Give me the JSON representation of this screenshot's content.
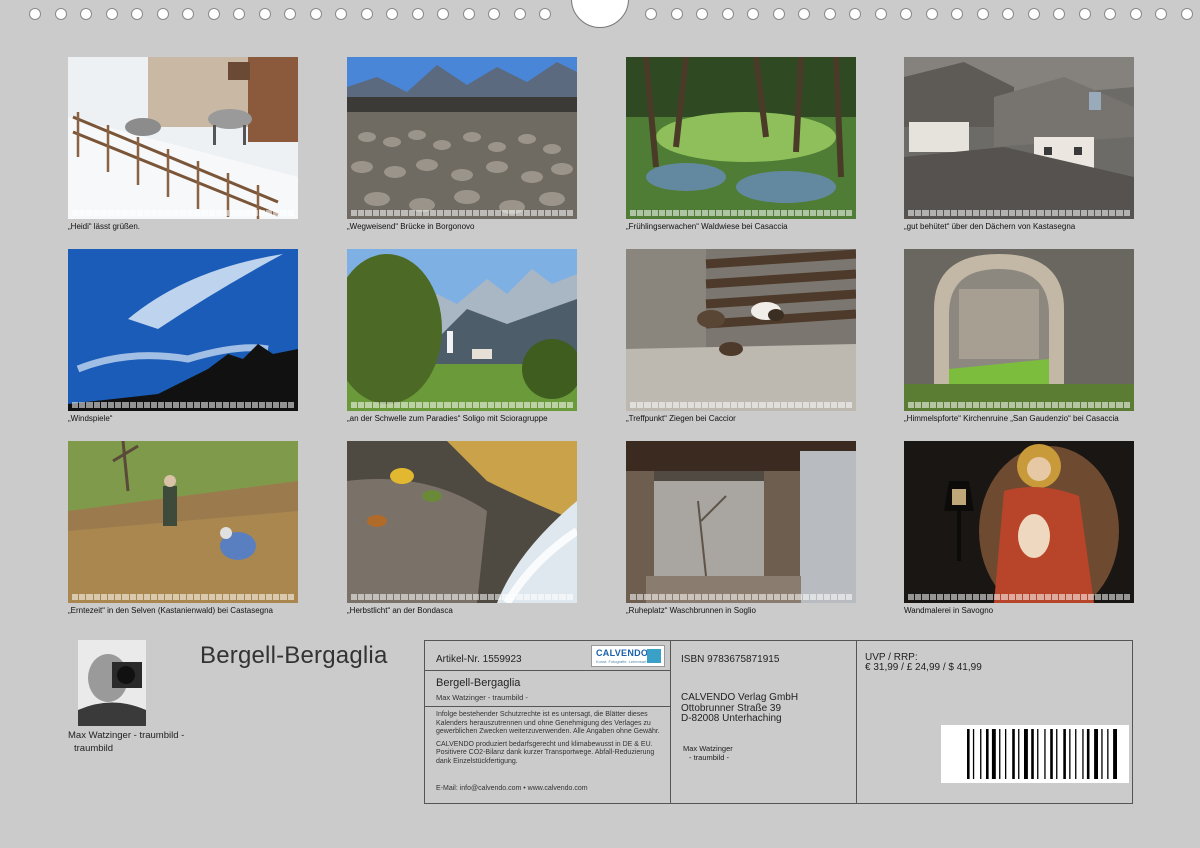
{
  "grid": [
    {
      "caption": "„Heidi“ lässt grüßen.",
      "scene": "winter-goats"
    },
    {
      "caption": "„Wegweisend“ Brücke in Borgonovo",
      "scene": "cobblestone-bridge"
    },
    {
      "caption": "„Frühlingserwachen“ Waldwiese bei Casaccia",
      "scene": "forest-meadow"
    },
    {
      "caption": "„gut behütet“ über den Dächern von Kastasegna",
      "scene": "stone-roofs"
    },
    {
      "caption": "„Windspiele“",
      "scene": "clouds-peaks"
    },
    {
      "caption": "„an der Schwelle zum Paradies“ Soligo mit Scioragruppe",
      "scene": "alpine-village"
    },
    {
      "caption": "„Treffpunkt“ Ziegen bei Caccior",
      "scene": "goats-wall"
    },
    {
      "caption": "„Himmelspforte“ Kirchenruine „San Gaudenzio“ bei Casaccia",
      "scene": "church-ruin"
    },
    {
      "caption": "„Erntezeit“  in den Selven (Kastanienwald) bei Castasegna",
      "scene": "chestnut-harvest"
    },
    {
      "caption": "„Herbstlicht“ an der Bondasca",
      "scene": "autumn-stream"
    },
    {
      "caption": "„Ruheplatz“ Waschbrunnen in Soglio",
      "scene": "wash-fountain"
    },
    {
      "caption": "Wandmalerei in Savogno",
      "scene": "fresco-lantern"
    }
  ],
  "title": "Bergell-Bergaglia",
  "author": {
    "line1": "Max Watzinger - traumbild -",
    "line2": "traumbild"
  },
  "info": {
    "article": "Artikel-Nr. 1559923",
    "logo": "CALVENDO",
    "logo_sub": "Kunst. Fotografie. Lebensart",
    "product_title": "Bergell-Bergaglia",
    "product_sub": "Max Watzinger - traumbild -",
    "legal1": "Infolge bestehender Schutzrechte ist es untersagt, die Blätter dieses Kalenders herauszutrennen und ohne Genehmigung des Verlages zu gewerblichen Zwecken weiterzuverwenden. Alle Angaben ohne Gewähr.",
    "legal2": "CALVENDO produziert bedarfsgerecht und klimabewusst in DE & EU. Positivere CO2-Bilanz dank kurzer Transportwege. Abfall-Reduzierung dank Einzelstückfertigung.",
    "contact": "E-Mail: info@calvendo.com • www.calvendo.com",
    "isbn": "ISBN 9783675871915",
    "publisher1": "CALVENDO Verlag GmbH",
    "publisher2": "Ottobrunner Straße 39",
    "publisher3": "D-82008 Unterhaching",
    "pub_author1": "Max Watzinger",
    "pub_author2": "- traumbild -",
    "price_label": "UVP / RRP:",
    "price": "€ 31,99 / £ 24,99 / $ 41,99"
  }
}
